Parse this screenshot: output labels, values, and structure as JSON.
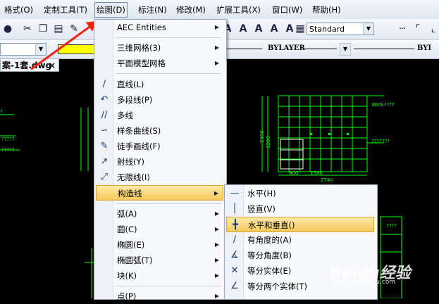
{
  "menubar": {
    "items": [
      "格式(O)",
      "定制工具(T)",
      "绘图(D)",
      "标注(N)",
      "修改(M)",
      "扩展工具(X)",
      "窗口(W)",
      "帮助(H)"
    ]
  },
  "toolbar": {
    "text_style": "Standard",
    "linetype": "BYLAYER",
    "lineweight_cut": "BYI"
  },
  "document": {
    "tab_title": "案-1套.dwg",
    "close_label": "×"
  },
  "draw_menu": {
    "items": [
      {
        "label": "AEC Entities",
        "submenu": true
      },
      {
        "label": "三维网格(3)",
        "submenu": true
      },
      {
        "label": "平面模型网格",
        "submenu": true
      },
      {
        "label": "直线(L)",
        "submenu": false
      },
      {
        "label": "多段线(P)",
        "submenu": false
      },
      {
        "label": "多线",
        "submenu": false
      },
      {
        "label": "样条曲线(S)",
        "submenu": false
      },
      {
        "label": "徒手画线(F)",
        "submenu": false
      },
      {
        "label": "射线(Y)",
        "submenu": false
      },
      {
        "label": "无限线(I)",
        "submenu": false
      },
      {
        "label": "构造线",
        "submenu": true
      },
      {
        "label": "弧(A)",
        "submenu": true
      },
      {
        "label": "圆(C)",
        "submenu": true
      },
      {
        "label": "椭圆(E)",
        "submenu": true
      },
      {
        "label": "椭圆弧(T)",
        "submenu": true
      },
      {
        "label": "块(K)",
        "submenu": true
      },
      {
        "label": "点(P)",
        "submenu": true
      }
    ]
  },
  "construction_submenu": {
    "items": [
      "水平(H)",
      "竖直(V)",
      "水平和垂直()",
      "有角度的(A)",
      "等分角度(B)",
      "等分实体(E)",
      "等分两个实体(T)"
    ]
  },
  "drawing": {
    "dims": [
      "2740",
      "1580",
      "600",
      "2300",
      "300",
      "1200"
    ]
  },
  "watermark": {
    "brand": "Baidu经验",
    "sub": "jingyan.baidu.com"
  },
  "colors": {
    "highlight": "#f6c95c",
    "cad_green": "#00ff00",
    "cad_yellow": "#ffff00",
    "arrow_red": "#e21e1e"
  }
}
